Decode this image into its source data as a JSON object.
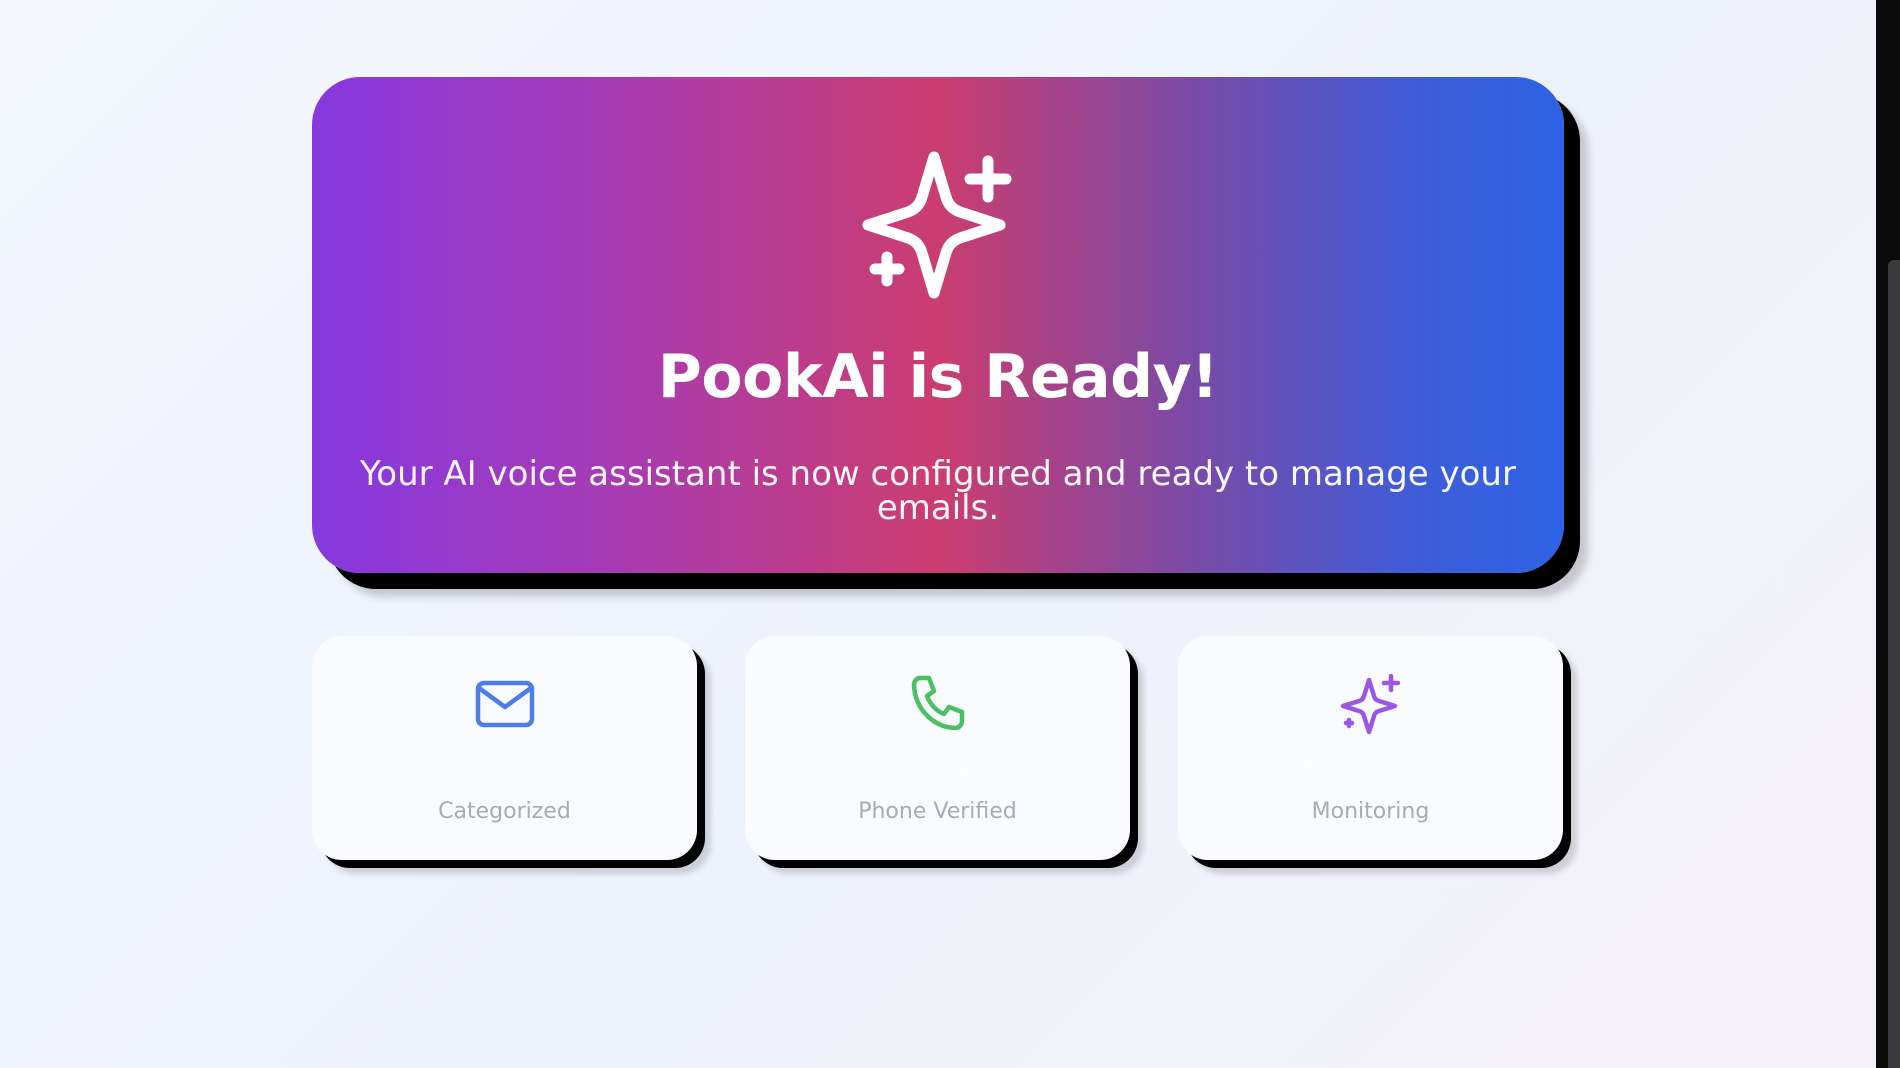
{
  "hero": {
    "icon": "sparkles-icon",
    "title": "PookAi is Ready!",
    "subtitle": "Your AI voice assistant is now configured and ready to manage your emails.",
    "gradient_colors": [
      "#8638e0",
      "#cb3d6f",
      "#2d63e5"
    ]
  },
  "stats": [
    {
      "icon": "mail-icon",
      "icon_color": "#4d7ee6",
      "value": "102 Senders",
      "label": "Categorized"
    },
    {
      "icon": "phone-icon",
      "icon_color": "#4bbf63",
      "value": "Voice Ready",
      "label": "Phone Verified"
    },
    {
      "icon": "sparkles-icon",
      "icon_color": "#9b56e6",
      "value": "AI Active",
      "label": "Monitoring"
    }
  ]
}
